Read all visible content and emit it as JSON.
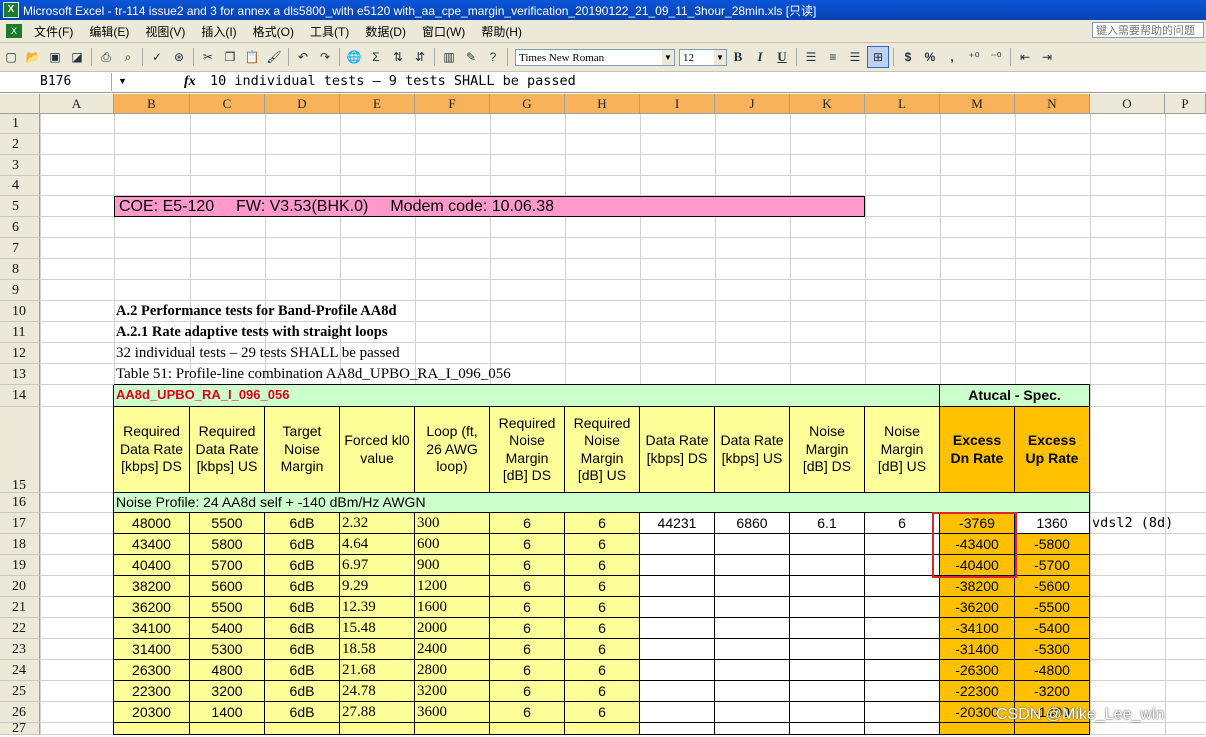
{
  "window": {
    "title": "Microsoft Excel - tr-114 issue2 and 3 for  annex a dls5800_with e5120 with_aa_cpe_margin_verification_20190122_21_09_11_3hour_28min.xls [只读]",
    "app_icon": "excel-icon"
  },
  "menu": {
    "items": [
      "文件(F)",
      "编辑(E)",
      "视图(V)",
      "插入(I)",
      "格式(O)",
      "工具(T)",
      "数据(D)",
      "窗口(W)",
      "帮助(H)"
    ],
    "help_placeholder": "键入需要帮助的问题"
  },
  "toolbar": {
    "font_name": "Times New Roman",
    "font_size": "12",
    "bold": "B",
    "italic": "I",
    "underline": "U",
    "currency": "$",
    "percent": "%",
    "comma": ","
  },
  "formula_bar": {
    "cell_ref": "B176",
    "fx": "fx",
    "content": "10 individual tests – 9 tests SHALL be passed"
  },
  "columns": [
    "A",
    "B",
    "C",
    "D",
    "E",
    "F",
    "G",
    "H",
    "I",
    "J",
    "K",
    "L",
    "M",
    "N",
    "O",
    "P"
  ],
  "rows": [
    "1",
    "2",
    "3",
    "4",
    "5",
    "6",
    "7",
    "8",
    "9",
    "10",
    "11",
    "12",
    "13",
    "14",
    "15",
    "16",
    "17",
    "18",
    "19",
    "20",
    "21",
    "22",
    "23",
    "24",
    "25",
    "26",
    "27"
  ],
  "sheet": {
    "banner": {
      "coe": "COE: E5-120",
      "fw": "FW:  V3.53(BHK.0)",
      "modem": "Modem code: 10.06.38"
    },
    "r10": "A.2 Performance tests for Band-Profile AA8d",
    "r11": "A.2.1 Rate adaptive tests with straight loops",
    "r12": "32 individual tests – 29 tests SHALL be passed",
    "r13": "Table 51: Profile-line combination AA8d_UPBO_RA_I_096_056",
    "profile_name": "AA8d_UPBO_RA_I_096_056",
    "atucal_spec": "Atucal - Spec.",
    "headers": [
      "Required Data Rate [kbps] DS",
      "Required Data Rate [kbps] US",
      "Target Noise Margin",
      "Forced kl0 value",
      "Loop (ft, 26 AWG loop)",
      "Required Noise Margin [dB] DS",
      "Required Noise Margin [dB] US",
      "Data Rate [kbps] DS",
      "Data Rate [kbps] US",
      "Noise Margin [dB] DS",
      "Noise Margin [dB] US",
      "Excess Dn Rate",
      "Excess Up Rate"
    ],
    "noise_profile": "Noise Profile: 24 AA8d self + -140 dBm/Hz AWGN",
    "o17": "vdsl2 (8d)",
    "data_rows": [
      [
        "48000",
        "5500",
        "6dB",
        "2.32",
        "300",
        "6",
        "6",
        "44231",
        "6860",
        "6.1",
        "6",
        "-3769",
        "1360"
      ],
      [
        "43400",
        "5800",
        "6dB",
        "4.64",
        "600",
        "6",
        "6",
        "",
        "",
        "",
        "",
        "-43400",
        "-5800"
      ],
      [
        "40400",
        "5700",
        "6dB",
        "6.97",
        "900",
        "6",
        "6",
        "",
        "",
        "",
        "",
        "-40400",
        "-5700"
      ],
      [
        "38200",
        "5600",
        "6dB",
        "9.29",
        "1200",
        "6",
        "6",
        "",
        "",
        "",
        "",
        "-38200",
        "-5600"
      ],
      [
        "36200",
        "5500",
        "6dB",
        "12.39",
        "1600",
        "6",
        "6",
        "",
        "",
        "",
        "",
        "-36200",
        "-5500"
      ],
      [
        "34100",
        "5400",
        "6dB",
        "15.48",
        "2000",
        "6",
        "6",
        "",
        "",
        "",
        "",
        "-34100",
        "-5400"
      ],
      [
        "31400",
        "5300",
        "6dB",
        "18.58",
        "2400",
        "6",
        "6",
        "",
        "",
        "",
        "",
        "-31400",
        "-5300"
      ],
      [
        "26300",
        "4800",
        "6dB",
        "21.68",
        "2800",
        "6",
        "6",
        "",
        "",
        "",
        "",
        "-26300",
        "-4800"
      ],
      [
        "22300",
        "3200",
        "6dB",
        "24.78",
        "3200",
        "6",
        "6",
        "",
        "",
        "",
        "",
        "-22300",
        "-3200"
      ],
      [
        "20300",
        "1400",
        "6dB",
        "27.88",
        "3600",
        "6",
        "6",
        "",
        "",
        "",
        "",
        "-20300",
        "-1400"
      ]
    ],
    "watermark": "CSDN @Mike_Lee_win"
  }
}
